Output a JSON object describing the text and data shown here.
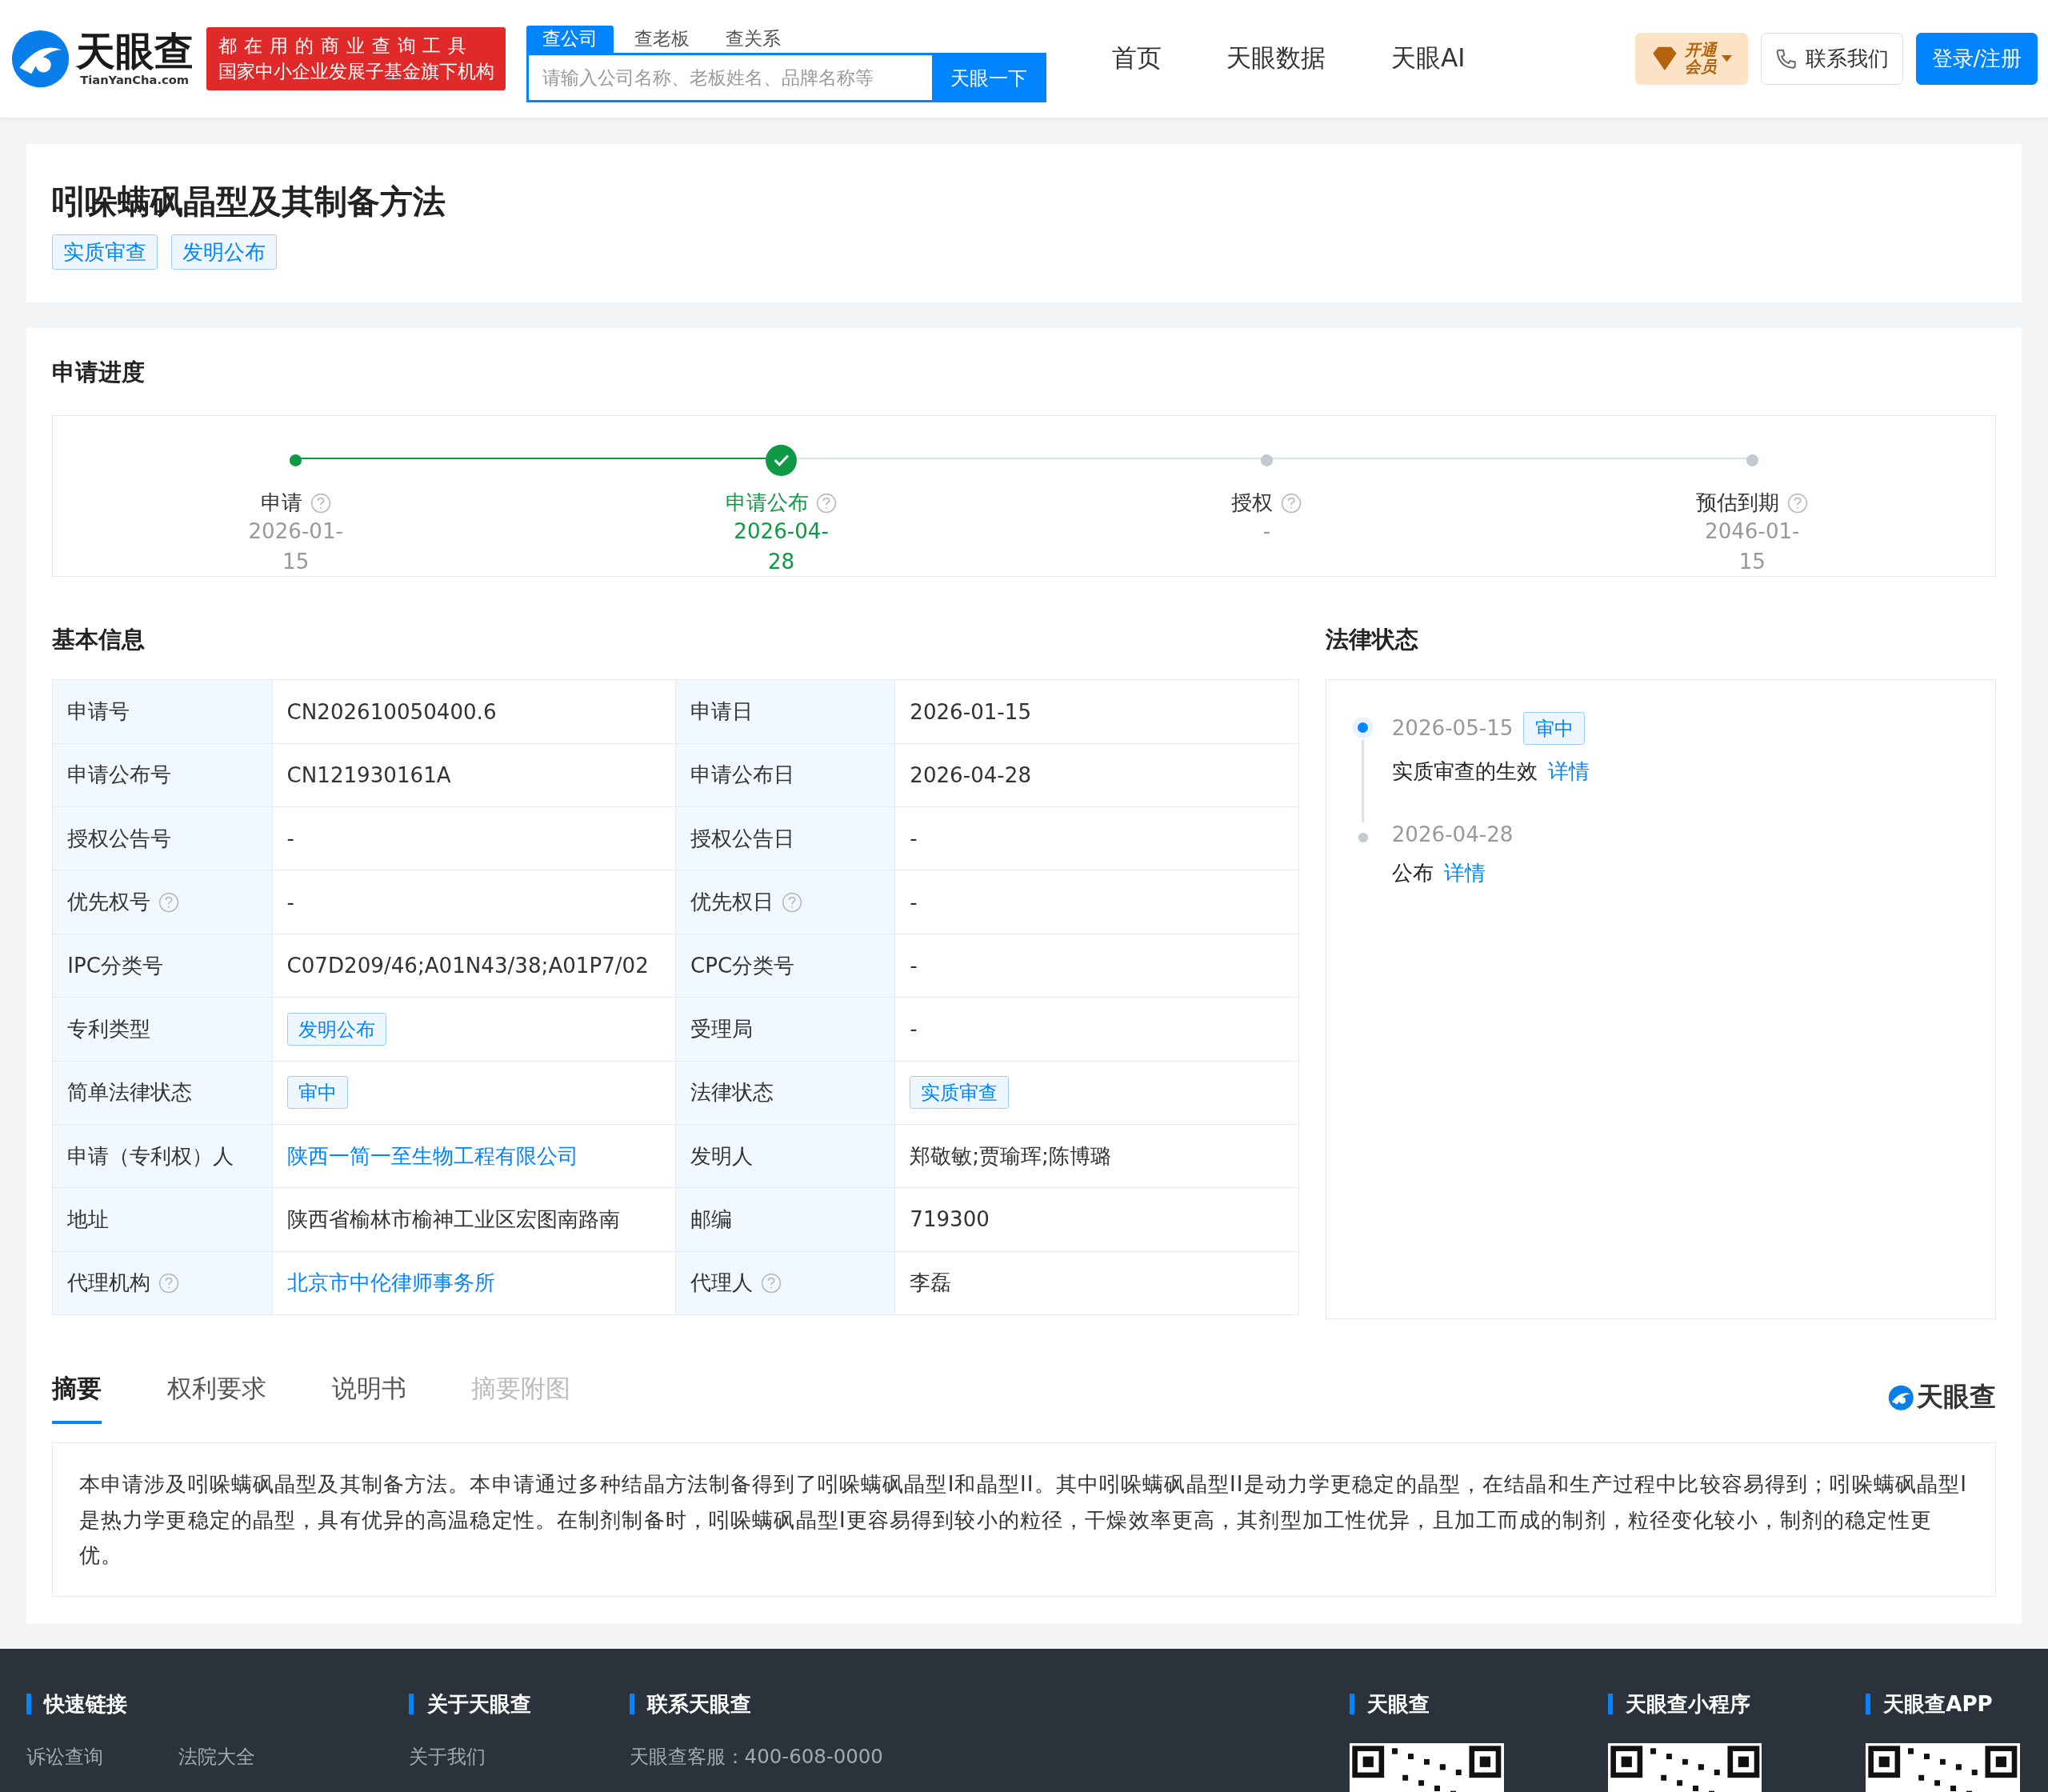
{
  "header": {
    "logo_text": "天眼查",
    "logo_sub": "TianYanCha.com",
    "slogan": [
      "都在用的商业查询工具",
      "国家中小企业发展子基金旗下机构"
    ],
    "search_tabs": [
      {
        "label": "查公司",
        "selected": true
      },
      {
        "label": "查老板",
        "selected": false
      },
      {
        "label": "查关系",
        "selected": false
      }
    ],
    "search": {
      "placeholder": "请输入公司名称、老板姓名、品牌名称等",
      "button": "天眼一下"
    },
    "nav": [
      "首页",
      "天眼数据",
      "天眼AI"
    ],
    "vip": [
      "开通",
      "会员"
    ],
    "contact": "联系我们",
    "login": "登录/注册"
  },
  "title": "吲哚螨砜晶型及其制备方法",
  "tags": [
    "实质审查",
    "发明公布"
  ],
  "progress": {
    "title": "申请进度",
    "steps": [
      {
        "label": "申请",
        "date": "2026-01-15",
        "reached": true,
        "current": false,
        "help": true
      },
      {
        "label": "申请公布",
        "date": "2026-04-28",
        "reached": true,
        "current": true,
        "help": true
      },
      {
        "label": "授权",
        "date": "-",
        "reached": false,
        "current": false,
        "help": true
      },
      {
        "label": "预估到期",
        "date": "2046-01-15",
        "reached": false,
        "current": false,
        "help": true
      }
    ]
  },
  "basic_info": {
    "title": "基本信息",
    "rows": [
      [
        {
          "label": "申请号",
          "value": "CN202610050400.6",
          "kind": "text",
          "help": false
        },
        {
          "label": "申请日",
          "value": "2026-01-15",
          "kind": "text",
          "help": false
        }
      ],
      [
        {
          "label": "申请公布号",
          "value": "CN121930161A",
          "kind": "text",
          "help": false
        },
        {
          "label": "申请公布日",
          "value": "2026-04-28",
          "kind": "text",
          "help": false
        }
      ],
      [
        {
          "label": "授权公告号",
          "value": "-",
          "kind": "text",
          "help": false
        },
        {
          "label": "授权公告日",
          "value": "-",
          "kind": "text",
          "help": false
        }
      ],
      [
        {
          "label": "优先权号",
          "value": "-",
          "kind": "text",
          "help": true
        },
        {
          "label": "优先权日",
          "value": "-",
          "kind": "text",
          "help": true
        }
      ],
      [
        {
          "label": "IPC分类号",
          "value": "C07D209/46;A01N43/38;A01P7/02",
          "kind": "text",
          "help": false
        },
        {
          "label": "CPC分类号",
          "value": "-",
          "kind": "text",
          "help": false
        }
      ],
      [
        {
          "label": "专利类型",
          "value": "发明公布",
          "kind": "tag",
          "help": false
        },
        {
          "label": "受理局",
          "value": "-",
          "kind": "text",
          "help": false
        }
      ],
      [
        {
          "label": "简单法律状态",
          "value": "审中",
          "kind": "tag",
          "help": false
        },
        {
          "label": "法律状态",
          "value": "实质审查",
          "kind": "tag",
          "help": false
        }
      ],
      [
        {
          "label": "申请（专利权）人",
          "value": "陕西一简一至生物工程有限公司",
          "kind": "link",
          "help": false
        },
        {
          "label": "发明人",
          "value": "郑敬敏;贾瑜珲;陈博璐",
          "kind": "text",
          "help": false
        }
      ],
      [
        {
          "label": "地址",
          "value": "陕西省榆林市榆神工业区宏图南路南",
          "kind": "text",
          "help": false
        },
        {
          "label": "邮编",
          "value": "719300",
          "kind": "text",
          "help": false
        }
      ],
      [
        {
          "label": "代理机构",
          "value": "北京市中伦律师事务所",
          "kind": "link",
          "help": true
        },
        {
          "label": "代理人",
          "value": "李磊",
          "kind": "text",
          "help": true
        }
      ]
    ]
  },
  "legal_status": {
    "title": "法律状态",
    "events": [
      {
        "date": "2026-05-15",
        "tag": "审中",
        "text": "实质审查的生效",
        "link": "详情",
        "active": true
      },
      {
        "date": "2026-04-28",
        "text": "公布",
        "link": "详情",
        "active": false
      }
    ]
  },
  "tabs": [
    {
      "label": "摘要",
      "selected": true,
      "disabled": false
    },
    {
      "label": "权利要求",
      "selected": false,
      "disabled": false
    },
    {
      "label": "说明书",
      "selected": false,
      "disabled": false
    },
    {
      "label": "摘要附图",
      "selected": false,
      "disabled": true
    }
  ],
  "brand": "天眼查",
  "abstract": "本申请涉及吲哚螨砜晶型及其制备方法。本申请通过多种结晶方法制备得到了吲哚螨砜晶型I和晶型II。其中吲哚螨砜晶型II是动力学更稳定的晶型，在结晶和生产过程中比较容易得到；吲哚螨砜晶型I是热力学更稳定的晶型，具有优异的高温稳定性。在制剂制备时，吲哚螨砜晶型I更容易得到较小的粒径，干燥效率更高，其剂型加工性优异，且加工而成的制剂，粒径变化较小，制剂的稳定性更优。",
  "footer": {
    "columns": [
      {
        "title": "快速链接",
        "links": [
          "诉讼查询",
          "法院大全"
        ],
        "kind": "links"
      },
      {
        "title": "关于天眼查",
        "links": [
          "关于我们"
        ],
        "kind": "links"
      },
      {
        "title": "联系天眼查",
        "links": [
          "天眼查客服：400-608-0000"
        ],
        "kind": "links"
      },
      {
        "title": "天眼查",
        "kind": "qr"
      },
      {
        "title": "天眼查小程序",
        "kind": "qr"
      },
      {
        "title": "天眼查APP",
        "kind": "qr"
      }
    ]
  }
}
